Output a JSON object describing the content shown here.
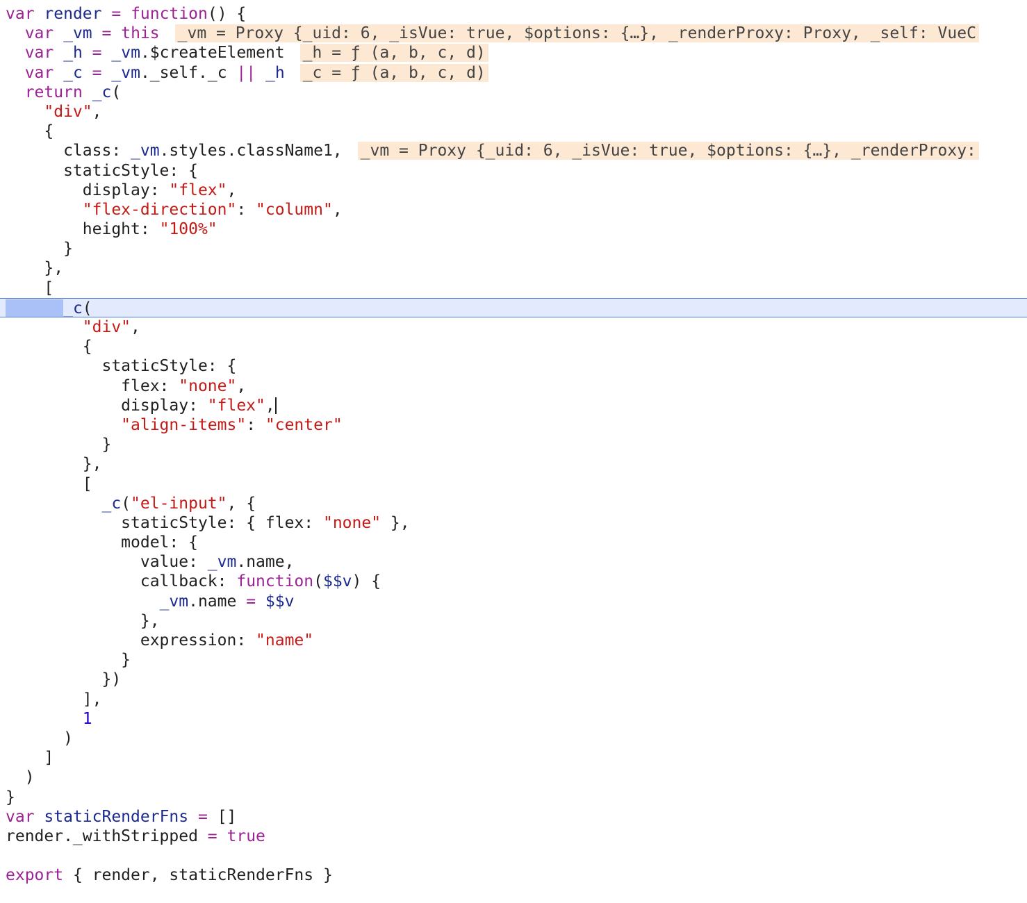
{
  "editor": {
    "lines": [
      {
        "tokens": [
          {
            "t": "var",
            "c": "kw"
          },
          {
            "t": " "
          },
          {
            "t": "render",
            "c": "id"
          },
          {
            "t": " "
          },
          {
            "t": "=",
            "c": "op"
          },
          {
            "t": " "
          },
          {
            "t": "function",
            "c": "kw"
          },
          {
            "t": "() {"
          }
        ]
      },
      {
        "tokens": [
          {
            "t": "  "
          },
          {
            "t": "var",
            "c": "kw"
          },
          {
            "t": " "
          },
          {
            "t": "_vm",
            "c": "id"
          },
          {
            "t": " "
          },
          {
            "t": "=",
            "c": "op"
          },
          {
            "t": " "
          },
          {
            "t": "this",
            "c": "kw"
          }
        ],
        "hint": "_vm = Proxy {_uid: 6, _isVue: true, $options: {…}, _renderProxy: Proxy, _self: VueC"
      },
      {
        "tokens": [
          {
            "t": "  "
          },
          {
            "t": "var",
            "c": "kw"
          },
          {
            "t": " "
          },
          {
            "t": "_h",
            "c": "id"
          },
          {
            "t": " "
          },
          {
            "t": "=",
            "c": "op"
          },
          {
            "t": " "
          },
          {
            "t": "_vm",
            "c": "id"
          },
          {
            "t": ".$createElement"
          }
        ],
        "hint": "_h = ƒ (a, b, c, d)"
      },
      {
        "tokens": [
          {
            "t": "  "
          },
          {
            "t": "var",
            "c": "kw"
          },
          {
            "t": " "
          },
          {
            "t": "_c",
            "c": "id"
          },
          {
            "t": " "
          },
          {
            "t": "=",
            "c": "op"
          },
          {
            "t": " "
          },
          {
            "t": "_vm",
            "c": "id"
          },
          {
            "t": "._self._c "
          },
          {
            "t": "||",
            "c": "op"
          },
          {
            "t": " "
          },
          {
            "t": "_h",
            "c": "id"
          }
        ],
        "hint": "_c = ƒ (a, b, c, d)"
      },
      {
        "tokens": [
          {
            "t": "  "
          },
          {
            "t": "return",
            "c": "kw"
          },
          {
            "t": " "
          },
          {
            "t": "_c",
            "c": "id"
          },
          {
            "t": "("
          }
        ]
      },
      {
        "tokens": [
          {
            "t": "    "
          },
          {
            "t": "\"div\"",
            "c": "str"
          },
          {
            "t": ","
          }
        ]
      },
      {
        "tokens": [
          {
            "t": "    {"
          }
        ]
      },
      {
        "tokens": [
          {
            "t": "      class: "
          },
          {
            "t": "_vm",
            "c": "id"
          },
          {
            "t": ".styles.className1,"
          }
        ],
        "hint": "_vm = Proxy {_uid: 6, _isVue: true, $options: {…}, _renderProxy:"
      },
      {
        "tokens": [
          {
            "t": "      staticStyle: {"
          }
        ]
      },
      {
        "tokens": [
          {
            "t": "        display: "
          },
          {
            "t": "\"flex\"",
            "c": "str"
          },
          {
            "t": ","
          }
        ]
      },
      {
        "tokens": [
          {
            "t": "        "
          },
          {
            "t": "\"flex-direction\"",
            "c": "str"
          },
          {
            "t": ": "
          },
          {
            "t": "\"column\"",
            "c": "str"
          },
          {
            "t": ","
          }
        ]
      },
      {
        "tokens": [
          {
            "t": "        height: "
          },
          {
            "t": "\"100%\"",
            "c": "str"
          }
        ]
      },
      {
        "tokens": [
          {
            "t": "      }"
          }
        ]
      },
      {
        "tokens": [
          {
            "t": "    },"
          }
        ]
      },
      {
        "tokens": [
          {
            "t": "    ["
          }
        ]
      },
      {
        "current": true,
        "tokens": [
          {
            "t": "      ",
            "c": "sel"
          },
          {
            "t": "_c",
            "c": "id"
          },
          {
            "t": "("
          }
        ]
      },
      {
        "tokens": [
          {
            "t": "        "
          },
          {
            "t": "\"div\"",
            "c": "str"
          },
          {
            "t": ","
          }
        ]
      },
      {
        "tokens": [
          {
            "t": "        {"
          }
        ]
      },
      {
        "tokens": [
          {
            "t": "          staticStyle: {"
          }
        ]
      },
      {
        "tokens": [
          {
            "t": "            flex: "
          },
          {
            "t": "\"none\"",
            "c": "str"
          },
          {
            "t": ","
          }
        ]
      },
      {
        "tokens": [
          {
            "t": "            display: "
          },
          {
            "t": "\"flex\"",
            "c": "str"
          },
          {
            "t": ","
          }
        ],
        "caret": true
      },
      {
        "tokens": [
          {
            "t": "            "
          },
          {
            "t": "\"align-items\"",
            "c": "str"
          },
          {
            "t": ": "
          },
          {
            "t": "\"center\"",
            "c": "str"
          }
        ]
      },
      {
        "tokens": [
          {
            "t": "          }"
          }
        ]
      },
      {
        "tokens": [
          {
            "t": "        },"
          }
        ]
      },
      {
        "tokens": [
          {
            "t": "        ["
          }
        ]
      },
      {
        "tokens": [
          {
            "t": "          "
          },
          {
            "t": "_c",
            "c": "id"
          },
          {
            "t": "("
          },
          {
            "t": "\"el-input\"",
            "c": "str"
          },
          {
            "t": ", {"
          }
        ]
      },
      {
        "tokens": [
          {
            "t": "            staticStyle: { flex: "
          },
          {
            "t": "\"none\"",
            "c": "str"
          },
          {
            "t": " },"
          }
        ]
      },
      {
        "tokens": [
          {
            "t": "            model: {"
          }
        ]
      },
      {
        "tokens": [
          {
            "t": "              value: "
          },
          {
            "t": "_vm",
            "c": "id"
          },
          {
            "t": ".name,"
          }
        ]
      },
      {
        "tokens": [
          {
            "t": "              callback: "
          },
          {
            "t": "function",
            "c": "kw"
          },
          {
            "t": "("
          },
          {
            "t": "$$v",
            "c": "id"
          },
          {
            "t": ") {"
          }
        ]
      },
      {
        "tokens": [
          {
            "t": "                "
          },
          {
            "t": "_vm",
            "c": "id"
          },
          {
            "t": ".name "
          },
          {
            "t": "=",
            "c": "op"
          },
          {
            "t": " "
          },
          {
            "t": "$$v",
            "c": "id"
          }
        ]
      },
      {
        "tokens": [
          {
            "t": "              },"
          }
        ]
      },
      {
        "tokens": [
          {
            "t": "              expression: "
          },
          {
            "t": "\"name\"",
            "c": "str"
          }
        ]
      },
      {
        "tokens": [
          {
            "t": "            }"
          }
        ]
      },
      {
        "tokens": [
          {
            "t": "          })"
          }
        ]
      },
      {
        "tokens": [
          {
            "t": "        ],"
          }
        ]
      },
      {
        "tokens": [
          {
            "t": "        "
          },
          {
            "t": "1",
            "c": "num"
          }
        ]
      },
      {
        "tokens": [
          {
            "t": "      )"
          }
        ]
      },
      {
        "tokens": [
          {
            "t": "    ]"
          }
        ]
      },
      {
        "tokens": [
          {
            "t": "  )"
          }
        ]
      },
      {
        "tokens": [
          {
            "t": "}"
          }
        ]
      },
      {
        "tokens": [
          {
            "t": "var",
            "c": "kw"
          },
          {
            "t": " "
          },
          {
            "t": "staticRenderFns",
            "c": "id"
          },
          {
            "t": " "
          },
          {
            "t": "=",
            "c": "op"
          },
          {
            "t": " []"
          }
        ]
      },
      {
        "tokens": [
          {
            "t": "render._withStripped "
          },
          {
            "t": "=",
            "c": "op"
          },
          {
            "t": " "
          },
          {
            "t": "true",
            "c": "kw"
          }
        ]
      },
      {
        "tokens": [
          {
            "t": ""
          }
        ]
      },
      {
        "tokens": [
          {
            "t": "export",
            "c": "kw"
          },
          {
            "t": " { render, staticRenderFns }"
          }
        ]
      }
    ]
  }
}
